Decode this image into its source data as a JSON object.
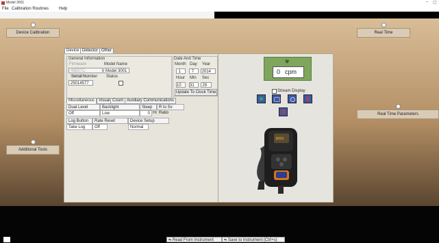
{
  "window": {
    "title": "Model 3001",
    "minimize_glyph": "–",
    "maximize_glyph": "▢"
  },
  "menu": {
    "items": [
      "File",
      "Calibration Routines",
      "Help"
    ]
  },
  "side_buttons": {
    "device_calibration": "Device Calibration",
    "real_time": "Real Time",
    "real_time_parameters": "Real Time Parameters",
    "additional_tools": "Additional Tools"
  },
  "top_tabs": [
    "Device",
    "Detector",
    "Other"
  ],
  "general_info": {
    "title": "General Information",
    "firmware_label": "Firmware",
    "firmware_value": "49837C-N30.3840",
    "model_name_label": "Model Name",
    "model_name_value": "Model 3001",
    "serial_label": "Serial Number",
    "serial_value": "25014577",
    "status_label": "Status"
  },
  "date_time": {
    "title": "Date And Time",
    "month_label": "Month",
    "day_label": "Day",
    "year_label": "Year",
    "month": "1",
    "day": "7",
    "year": "2014",
    "hour_label": "Hour",
    "min_label": "Min",
    "sec_label": "Sec",
    "hour": "10",
    "min": "31",
    "sec": "29",
    "update_button": "Update To Clock Time"
  },
  "sub_tabs": [
    "Miscellaneous",
    "Visual",
    "Count",
    "Auxiliary Communications"
  ],
  "misc_grid": {
    "h1": "Dual Level Audio",
    "h2": "Backlight Threshold",
    "h3": "Sleep",
    "h4": "R to Sv Ratio",
    "v1": "Off",
    "v2": "Low",
    "v3": "0",
    "v3_unit": "Hr",
    "h5": "Log Button",
    "h6": "Rate Reset Button",
    "h7": "Device Setup Protect",
    "v5": "Take Log",
    "v6": "Off",
    "v7": "Normal"
  },
  "readout": {
    "value": "0",
    "unit": "cpm"
  },
  "stream_display_label": "Stream Display",
  "bottom": {
    "read_button": "Read From Instrument",
    "save_button": "Save to Instrument (Ctrl+s)"
  },
  "colors": {
    "sand_top": "#d8bd97",
    "readout_green": "#7fa65c",
    "icon_blue": "#3d5ba8",
    "device_orange": "#d9731f"
  }
}
